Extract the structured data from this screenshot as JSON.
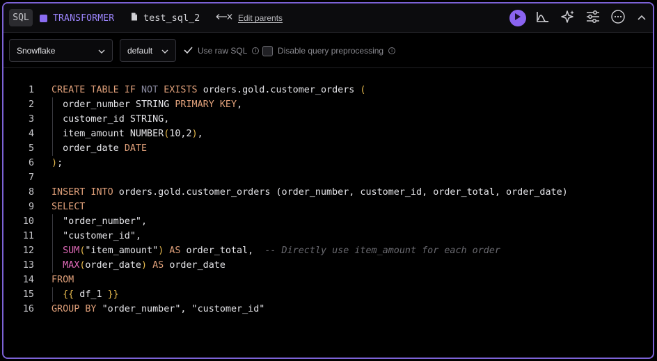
{
  "header": {
    "lang_badge": "SQL",
    "cell_type": "TRANSFORMER",
    "cell_name": "test_sql_2",
    "edit_parents": "Edit parents",
    "colors": {
      "accent": "#8a63f0",
      "border": "#7c62d6"
    },
    "icons": [
      "run-icon",
      "chart-icon",
      "sparkle-icon",
      "sliders-icon",
      "more-icon",
      "chevron-up-icon"
    ]
  },
  "toolbar": {
    "warehouse": "Snowflake",
    "schema": "default",
    "use_raw_sql": {
      "label": "Use raw SQL",
      "checked": true
    },
    "disable_preprocessing": {
      "label": "Disable query preprocessing",
      "checked": false
    }
  },
  "editor": {
    "line_numbers": [
      "1",
      "2",
      "3",
      "4",
      "5",
      "6",
      "7",
      "8",
      "9",
      "10",
      "11",
      "12",
      "13",
      "14",
      "15",
      "16"
    ],
    "lines": [
      [
        [
          "kw",
          "CREATE TABLE IF "
        ],
        [
          "dim",
          "NOT"
        ],
        [
          "kw",
          " EXISTS "
        ],
        [
          "id",
          "orders.gold.customer_orders "
        ],
        [
          "punc",
          "("
        ]
      ],
      [
        [
          "id",
          "  order_number STRING "
        ],
        [
          "kw",
          "PRIMARY KEY"
        ],
        [
          "id",
          ","
        ]
      ],
      [
        [
          "id",
          "  customer_id STRING,"
        ]
      ],
      [
        [
          "id",
          "  item_amount NUMBER"
        ],
        [
          "punc",
          "("
        ],
        [
          "num",
          "10,2"
        ],
        [
          "punc",
          ")"
        ],
        [
          "id",
          ","
        ]
      ],
      [
        [
          "id",
          "  order_date "
        ],
        [
          "kw",
          "DATE"
        ]
      ],
      [
        [
          "punc",
          ")"
        ],
        [
          "id",
          ";"
        ]
      ],
      [],
      [
        [
          "kw",
          "INSERT INTO "
        ],
        [
          "id",
          "orders.gold.customer_orders (order_number, customer_id, order_total, order_date)"
        ]
      ],
      [
        [
          "kw",
          "SELECT"
        ]
      ],
      [
        [
          "str",
          "  \"order_number\","
        ]
      ],
      [
        [
          "str",
          "  \"customer_id\","
        ]
      ],
      [
        [
          "id",
          "  "
        ],
        [
          "fn",
          "SUM"
        ],
        [
          "punc",
          "("
        ],
        [
          "str",
          "\"item_amount\""
        ],
        [
          "punc",
          ")"
        ],
        [
          "kw",
          " AS "
        ],
        [
          "id",
          "order_total,  "
        ],
        [
          "com",
          "-- Directly use item_amount for each order"
        ]
      ],
      [
        [
          "id",
          "  "
        ],
        [
          "fn",
          "MAX"
        ],
        [
          "punc",
          "("
        ],
        [
          "id",
          "order_date"
        ],
        [
          "punc",
          ")"
        ],
        [
          "kw",
          " AS "
        ],
        [
          "id",
          "order_date"
        ]
      ],
      [
        [
          "kw",
          "FROM"
        ]
      ],
      [
        [
          "id",
          "  "
        ],
        [
          "tpl",
          "{{"
        ],
        [
          "id",
          " df_1 "
        ],
        [
          "tpl",
          "}}"
        ]
      ],
      [
        [
          "kw",
          "GROUP BY "
        ],
        [
          "str",
          "\"order_number\", \"customer_id\""
        ]
      ]
    ]
  }
}
